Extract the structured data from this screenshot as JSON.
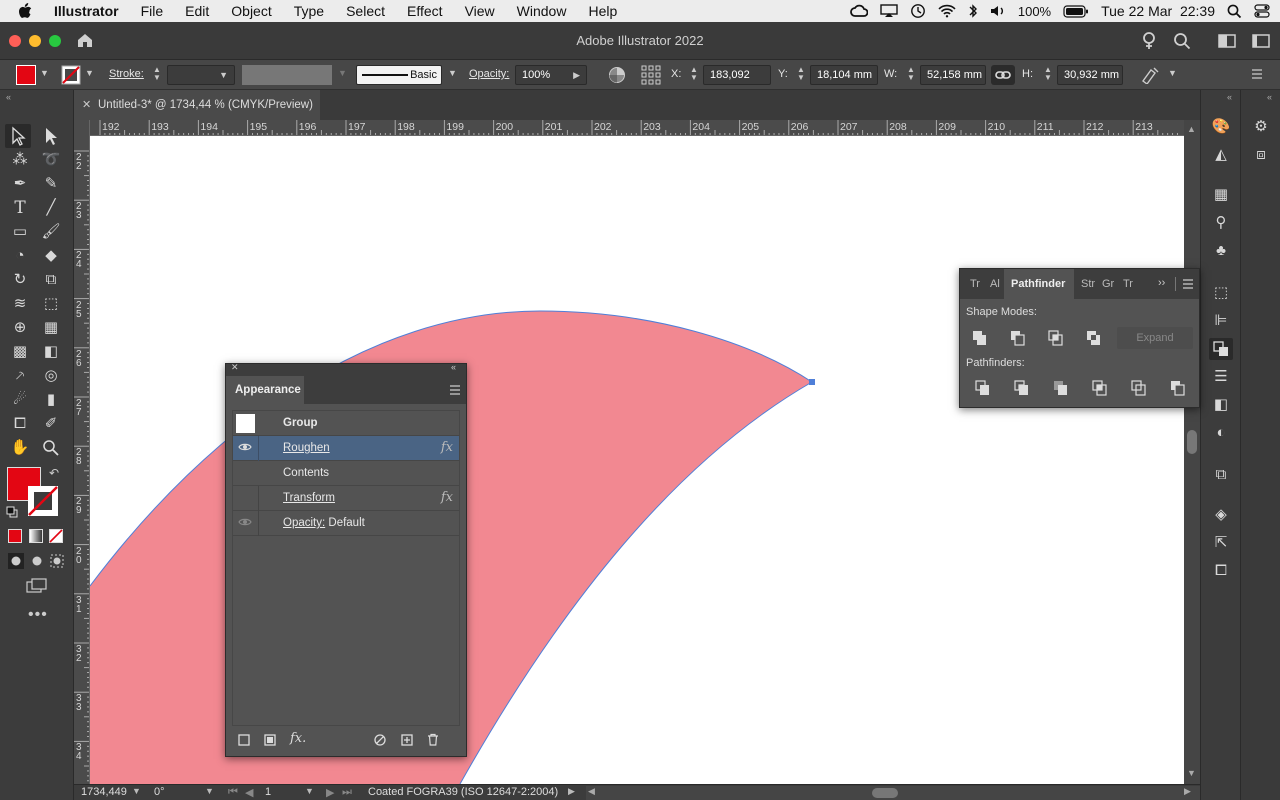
{
  "menubar": {
    "app_name": "Illustrator",
    "items": [
      "File",
      "Edit",
      "Object",
      "Type",
      "Select",
      "Effect",
      "View",
      "Window",
      "Help"
    ],
    "battery": "100%",
    "clock": "Tue 22 Mar  22:39"
  },
  "window": {
    "title": "Adobe Illustrator 2022"
  },
  "controlbar": {
    "stroke_label": "Stroke:",
    "brush_label": "Basic",
    "opacity_label": "Opacity:",
    "opacity_value": "100%",
    "x_label": "X:",
    "x_value": "183,092 mm",
    "y_label": "Y:",
    "y_value": "18,104 mm",
    "w_label": "W:",
    "w_value": "52,158 mm",
    "h_label": "H:",
    "h_value": "30,932 mm"
  },
  "document": {
    "tab_title": "Untitled-3* @ 1734,44 % (CMYK/Preview)"
  },
  "rulers": {
    "horizontal": [
      "192",
      "193",
      "194",
      "195",
      "196",
      "197",
      "198",
      "199",
      "200",
      "201",
      "202",
      "203",
      "204",
      "205",
      "206",
      "207",
      "208",
      "209",
      "210",
      "211",
      "212",
      "213"
    ],
    "vertical": [
      "2",
      "2",
      "2",
      "2",
      "2",
      "2",
      "2",
      "2",
      "2",
      "3",
      "3",
      "3",
      "3",
      "3"
    ],
    "vertical_sub": [
      "2",
      "3",
      "4",
      "5",
      "6",
      "7",
      "8",
      "9",
      "0",
      "1",
      "2",
      "3",
      "4",
      "5"
    ]
  },
  "colors": {
    "fill": "#e30613",
    "shape": "#f28891",
    "selection": "#4f7fd8"
  },
  "appearance": {
    "tab_label": "Appearance",
    "rows": [
      {
        "label": "Group",
        "selected": false
      },
      {
        "label": "Roughen",
        "selected": true,
        "fx": "fx"
      },
      {
        "label": "Contents",
        "selected": false
      },
      {
        "label": "Transform",
        "selected": false,
        "fx": "fx"
      },
      {
        "label": "Opacity:",
        "value": "Default",
        "selected": false
      }
    ],
    "footer_fx": "fx."
  },
  "pathfinder": {
    "tabs": [
      "Tr",
      "Al",
      "Pathfinder",
      "Str",
      "Gr",
      "Tr"
    ],
    "shape_modes_label": "Shape Modes:",
    "expand_label": "Expand",
    "pathfinders_label": "Pathfinders:"
  },
  "statusbar": {
    "zoom": "1734,449",
    "rotation": "0°",
    "artboard": "1",
    "profile": "Coated FOGRA39 (ISO 12647-2:2004)"
  }
}
